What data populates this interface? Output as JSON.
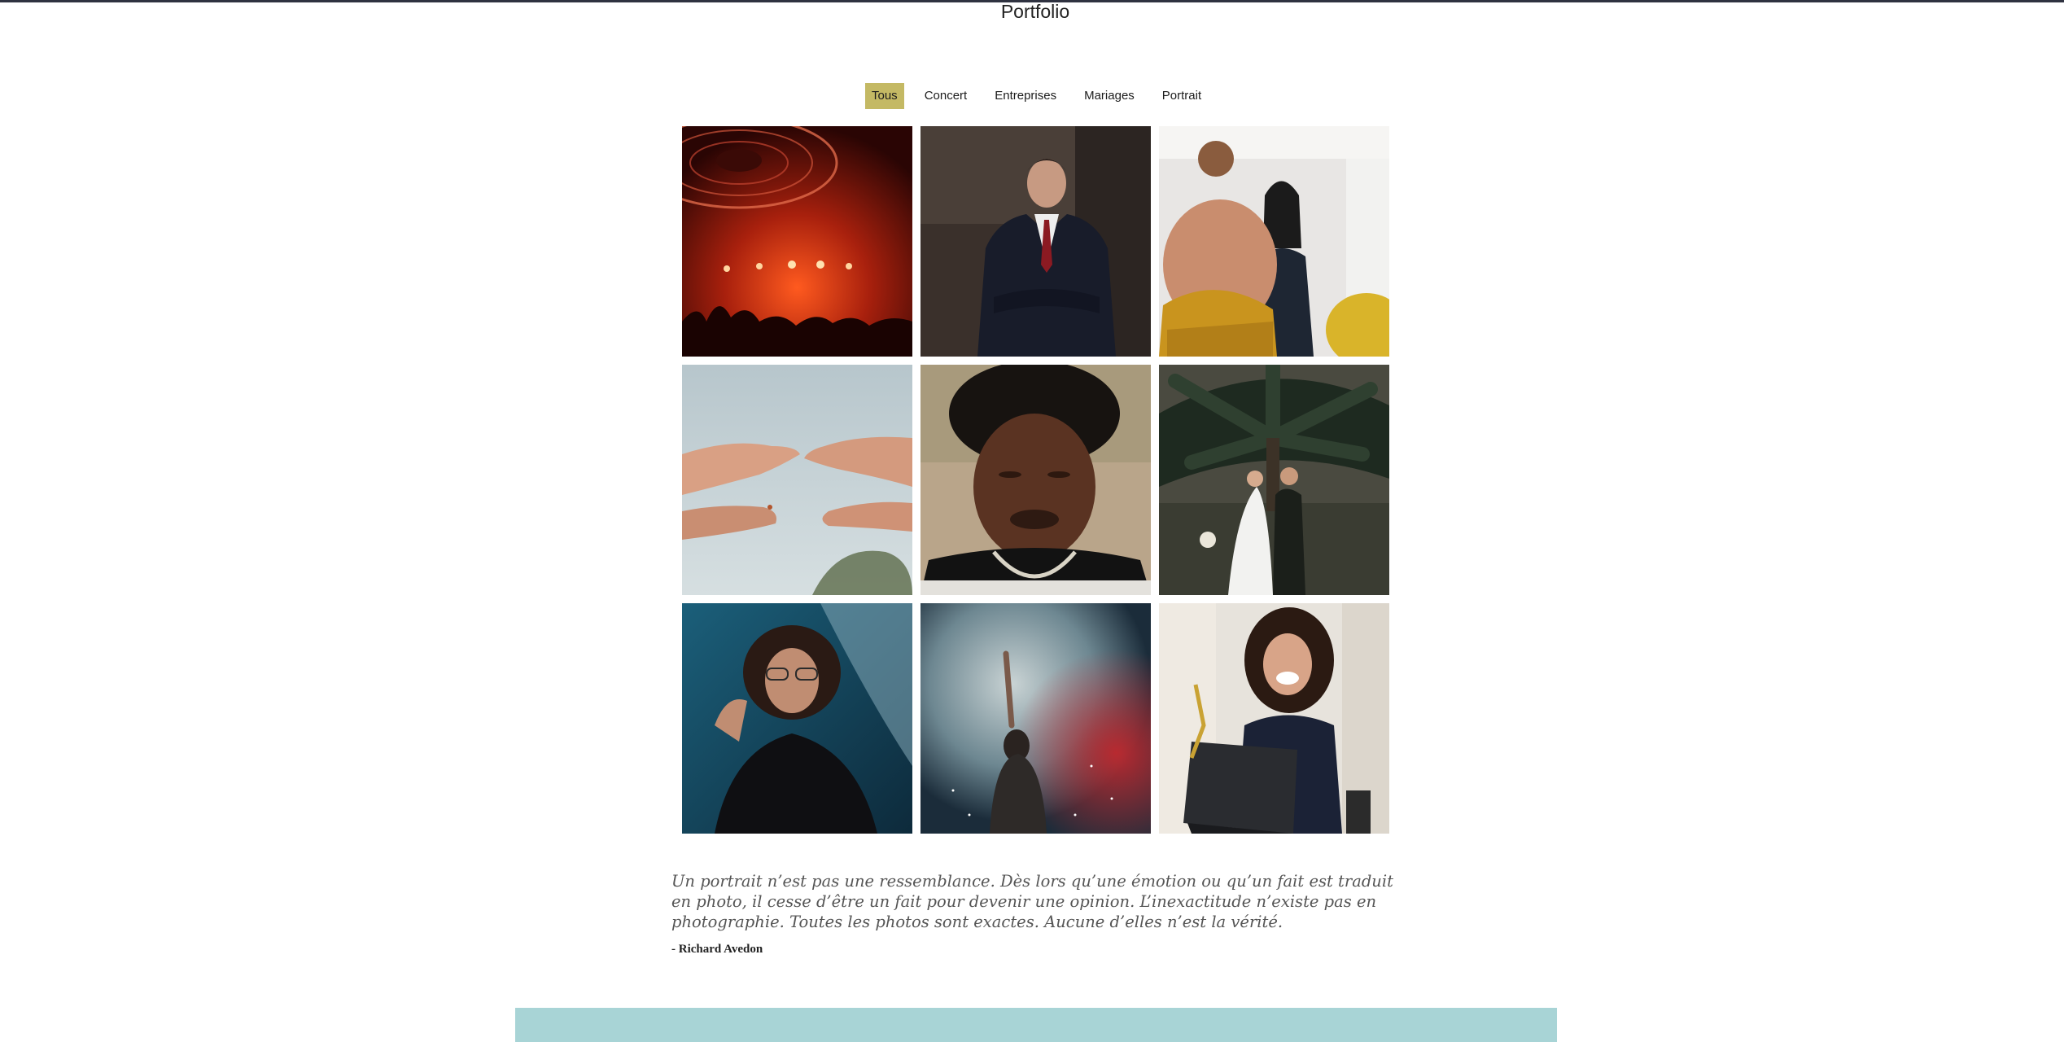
{
  "page": {
    "title": "Portfolio"
  },
  "filters": [
    {
      "label": "Tous",
      "active": true
    },
    {
      "label": "Concert",
      "active": false
    },
    {
      "label": "Entreprises",
      "active": false
    },
    {
      "label": "Mariages",
      "active": false
    },
    {
      "label": "Portrait",
      "active": false
    }
  ],
  "gallery": [
    {
      "subject": "concert-stage-red-lights"
    },
    {
      "subject": "businessman-dark-suit"
    },
    {
      "subject": "office-meeting-smiling-woman"
    },
    {
      "subject": "hands-touching-sky"
    },
    {
      "subject": "man-eyes-closed-portrait"
    },
    {
      "subject": "wedding-couple-palm-tree"
    },
    {
      "subject": "young-woman-glasses-fence"
    },
    {
      "subject": "performer-smoke-red"
    },
    {
      "subject": "woman-laughing-laptop"
    }
  ],
  "quote": {
    "text": "Un portrait n’est pas une ressemblance. Dès lors qu’une émotion ou qu’un fait est traduit en photo, il cesse d’être un fait pour devenir une opinion. L’inexactitude n’existe pas en photographie. Toutes les photos sont exactes. Aucune d’elles n’est la vérité.",
    "author": "- Richard Avedon"
  },
  "colors": {
    "topbar": "#2f3240",
    "active_filter": "#c4b964",
    "footer_band": "#a8d4d6"
  }
}
